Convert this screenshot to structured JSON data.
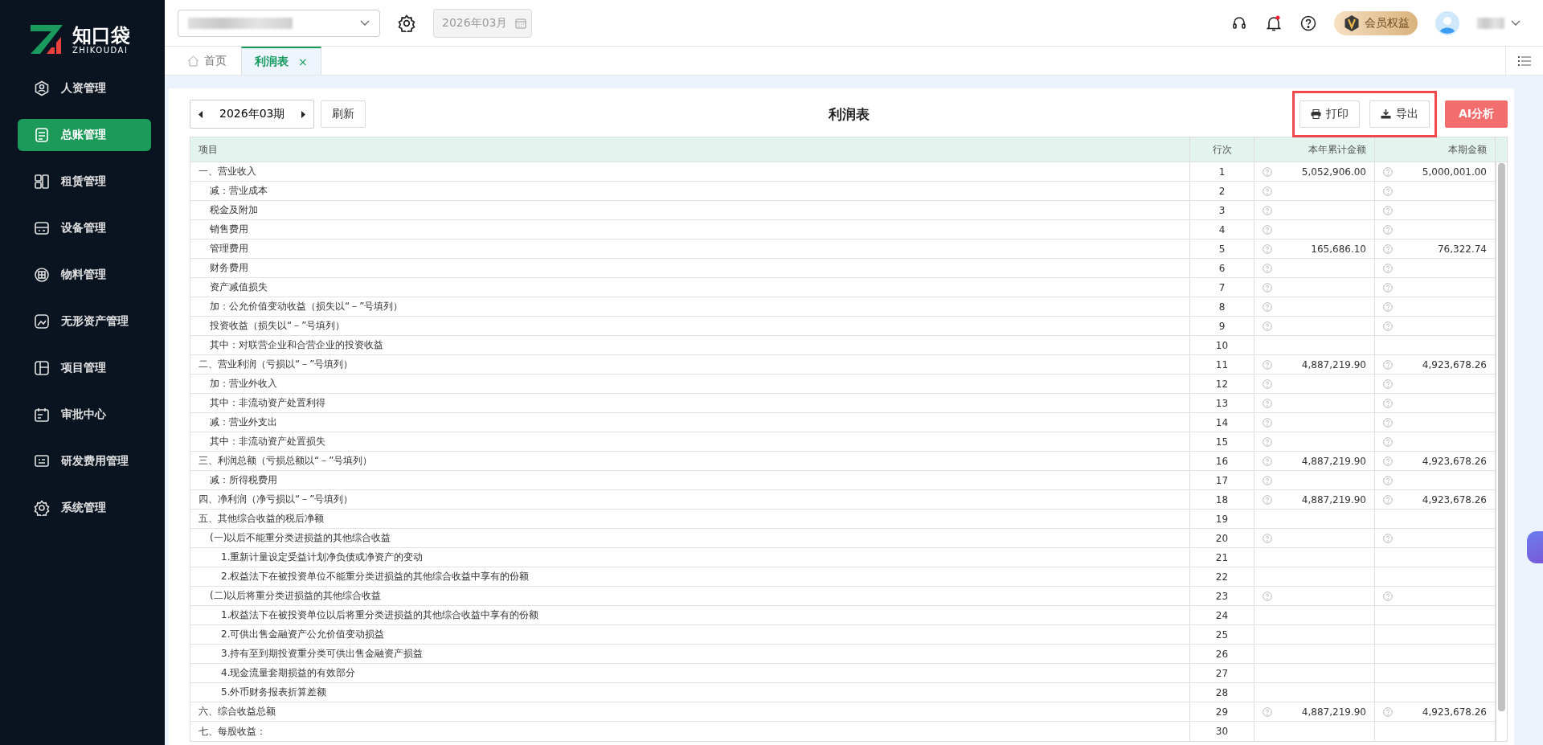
{
  "logo": {
    "name": "知口袋",
    "latin": "ZHIKOUDAI"
  },
  "sidebar": {
    "items": [
      {
        "label": "人资管理",
        "selected": false
      },
      {
        "label": "总账管理",
        "selected": true
      },
      {
        "label": "租赁管理",
        "selected": false
      },
      {
        "label": "设备管理",
        "selected": false
      },
      {
        "label": "物料管理",
        "selected": false
      },
      {
        "label": "无形资产管理",
        "selected": false
      },
      {
        "label": "项目管理",
        "selected": false
      },
      {
        "label": "审批中心",
        "selected": false
      },
      {
        "label": "研发费用管理",
        "selected": false
      },
      {
        "label": "系统管理",
        "selected": false
      }
    ]
  },
  "header": {
    "month_field": {
      "value": "2026年03月",
      "disabled": true
    },
    "notifications_unread": true,
    "member_badge": "会员权益"
  },
  "tabs": [
    {
      "label": "首页",
      "kind": "home",
      "selected": false
    },
    {
      "label": "利润表",
      "kind": "page",
      "selected": true,
      "close": "×"
    }
  ],
  "toolbar": {
    "period": "2026年03期",
    "refresh": "刷新",
    "title": "利润表",
    "highlighted_actions": [
      {
        "label": "打印",
        "kind": "print"
      },
      {
        "label": "导出",
        "kind": "export"
      }
    ],
    "actions": [
      {
        "label": "AI分析",
        "kind": "ai"
      }
    ]
  },
  "table": {
    "columns": [
      "项目",
      "行次",
      "本年累计金额",
      "本期金额"
    ],
    "rows": [
      {
        "item": "一、营业收入",
        "line": "1",
        "help": true,
        "ytd": "5,052,906.00",
        "period": "5,000,001.00",
        "children": [
          {
            "item": "减：营业成本",
            "line": "2",
            "help": true
          },
          {
            "item": "税金及附加",
            "line": "3",
            "help": true
          },
          {
            "item": "销售费用",
            "line": "4",
            "help": true
          },
          {
            "item": "管理费用",
            "line": "5",
            "help": true,
            "ytd": "165,686.10",
            "period": "76,322.74"
          },
          {
            "item": "财务费用",
            "line": "6",
            "help": true
          },
          {
            "item": "资产减值损失",
            "line": "7",
            "help": true
          },
          {
            "item": "加：公允价值变动收益（损失以“－”号填列）",
            "line": "8",
            "help": true
          },
          {
            "item": "投资收益（损失以“－”号填列）",
            "line": "9",
            "help": true
          },
          {
            "item": "其中：对联营企业和合营企业的投资收益",
            "line": "10",
            "help": false
          }
        ]
      },
      {
        "item": "二、营业利润（亏损以“－”号填列）",
        "line": "11",
        "help": true,
        "ytd": "4,887,219.90",
        "period": "4,923,678.26",
        "children": [
          {
            "item": "加：营业外收入",
            "line": "12",
            "help": true
          },
          {
            "item": "其中：非流动资产处置利得",
            "line": "13",
            "help": true
          },
          {
            "item": "减：营业外支出",
            "line": "14",
            "help": true
          },
          {
            "item": "其中：非流动资产处置损失",
            "line": "15",
            "help": true
          }
        ]
      },
      {
        "item": "三、利润总额（亏损总额以“－”号填列）",
        "line": "16",
        "help": true,
        "ytd": "4,887,219.90",
        "period": "4,923,678.26",
        "children": [
          {
            "item": "减：所得税费用",
            "line": "17",
            "help": true
          }
        ]
      },
      {
        "item": "四、净利润（净亏损以“－”号填列）",
        "line": "18",
        "help": true,
        "ytd": "4,887,219.90",
        "period": "4,923,678.26"
      },
      {
        "item": "五、其他综合收益的税后净额",
        "line": "19",
        "help": false,
        "children": [
          {
            "item": "(一)以后不能重分类进损益的其他综合收益",
            "line": "20",
            "help": true,
            "children": [
              {
                "item": "1.重新计量设定受益计划净负债或净资产的变动",
                "line": "21",
                "help": false
              },
              {
                "item": "2.权益法下在被投资单位不能重分类进损益的其他综合收益中享有的份额",
                "line": "22",
                "help": false
              }
            ]
          },
          {
            "item": "(二)以后将重分类进损益的其他综合收益",
            "line": "23",
            "help": true,
            "children": [
              {
                "item": "1.权益法下在被投资单位以后将重分类进损益的其他综合收益中享有的份额",
                "line": "24",
                "help": false
              },
              {
                "item": "2.可供出售金融资产公允价值变动损益",
                "line": "25",
                "help": false
              },
              {
                "item": "3.持有至到期投资重分类可供出售金融资产损益",
                "line": "26",
                "help": false
              },
              {
                "item": "4.现金流量套期损益的有效部分",
                "line": "27",
                "help": false
              },
              {
                "item": "5.外币财务报表折算差额",
                "line": "28",
                "help": false
              }
            ]
          }
        ]
      },
      {
        "item": "六、综合收益总额",
        "line": "29",
        "help": true,
        "ytd": "4,887,219.90",
        "period": "4,923,678.26"
      },
      {
        "item": "七、每股收益：",
        "line": "30",
        "help": false
      }
    ]
  }
}
